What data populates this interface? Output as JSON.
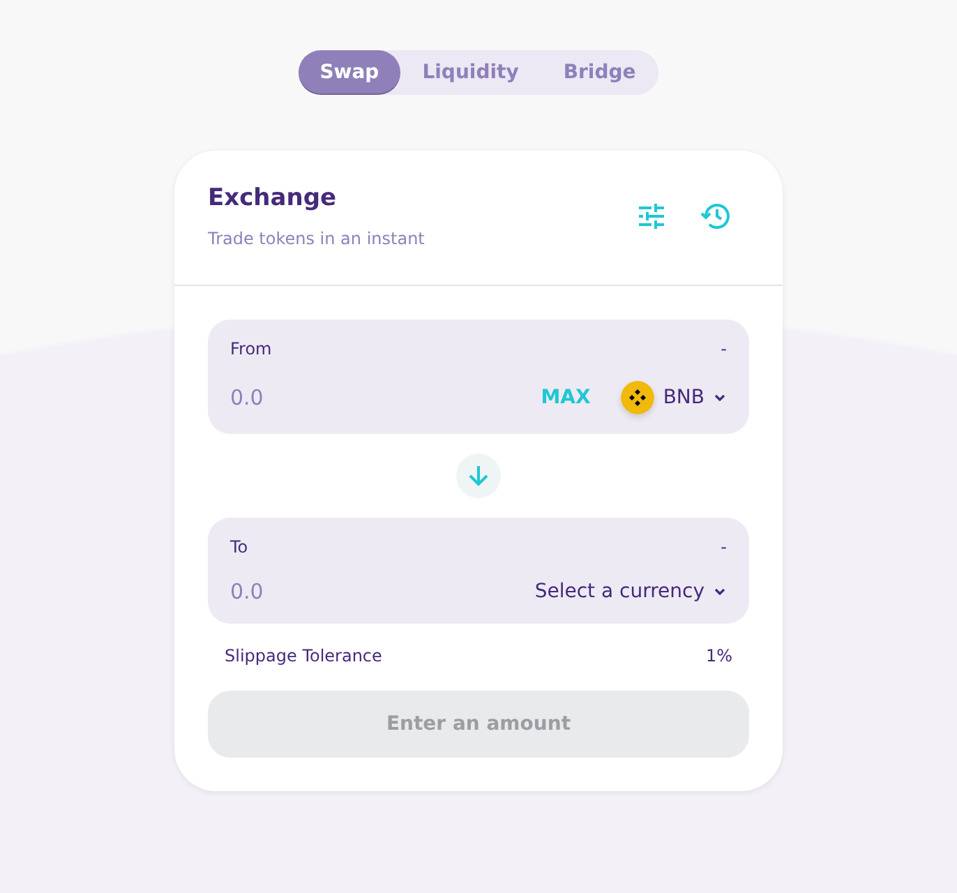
{
  "tabs": [
    {
      "label": "Swap",
      "selected": true
    },
    {
      "label": "Liquidity",
      "selected": false
    },
    {
      "label": "Bridge",
      "selected": false
    }
  ],
  "header": {
    "title": "Exchange",
    "subtitle": "Trade tokens in an instant"
  },
  "from": {
    "label": "From",
    "balance": "-",
    "placeholder": "0.0",
    "max": "MAX",
    "token": "BNB"
  },
  "to": {
    "label": "To",
    "balance": "-",
    "placeholder": "0.0",
    "select": "Select a currency"
  },
  "slippage": {
    "label": "Slippage Tolerance",
    "value": "1%"
  },
  "submit": {
    "label": "Enter an amount",
    "disabled": true
  }
}
